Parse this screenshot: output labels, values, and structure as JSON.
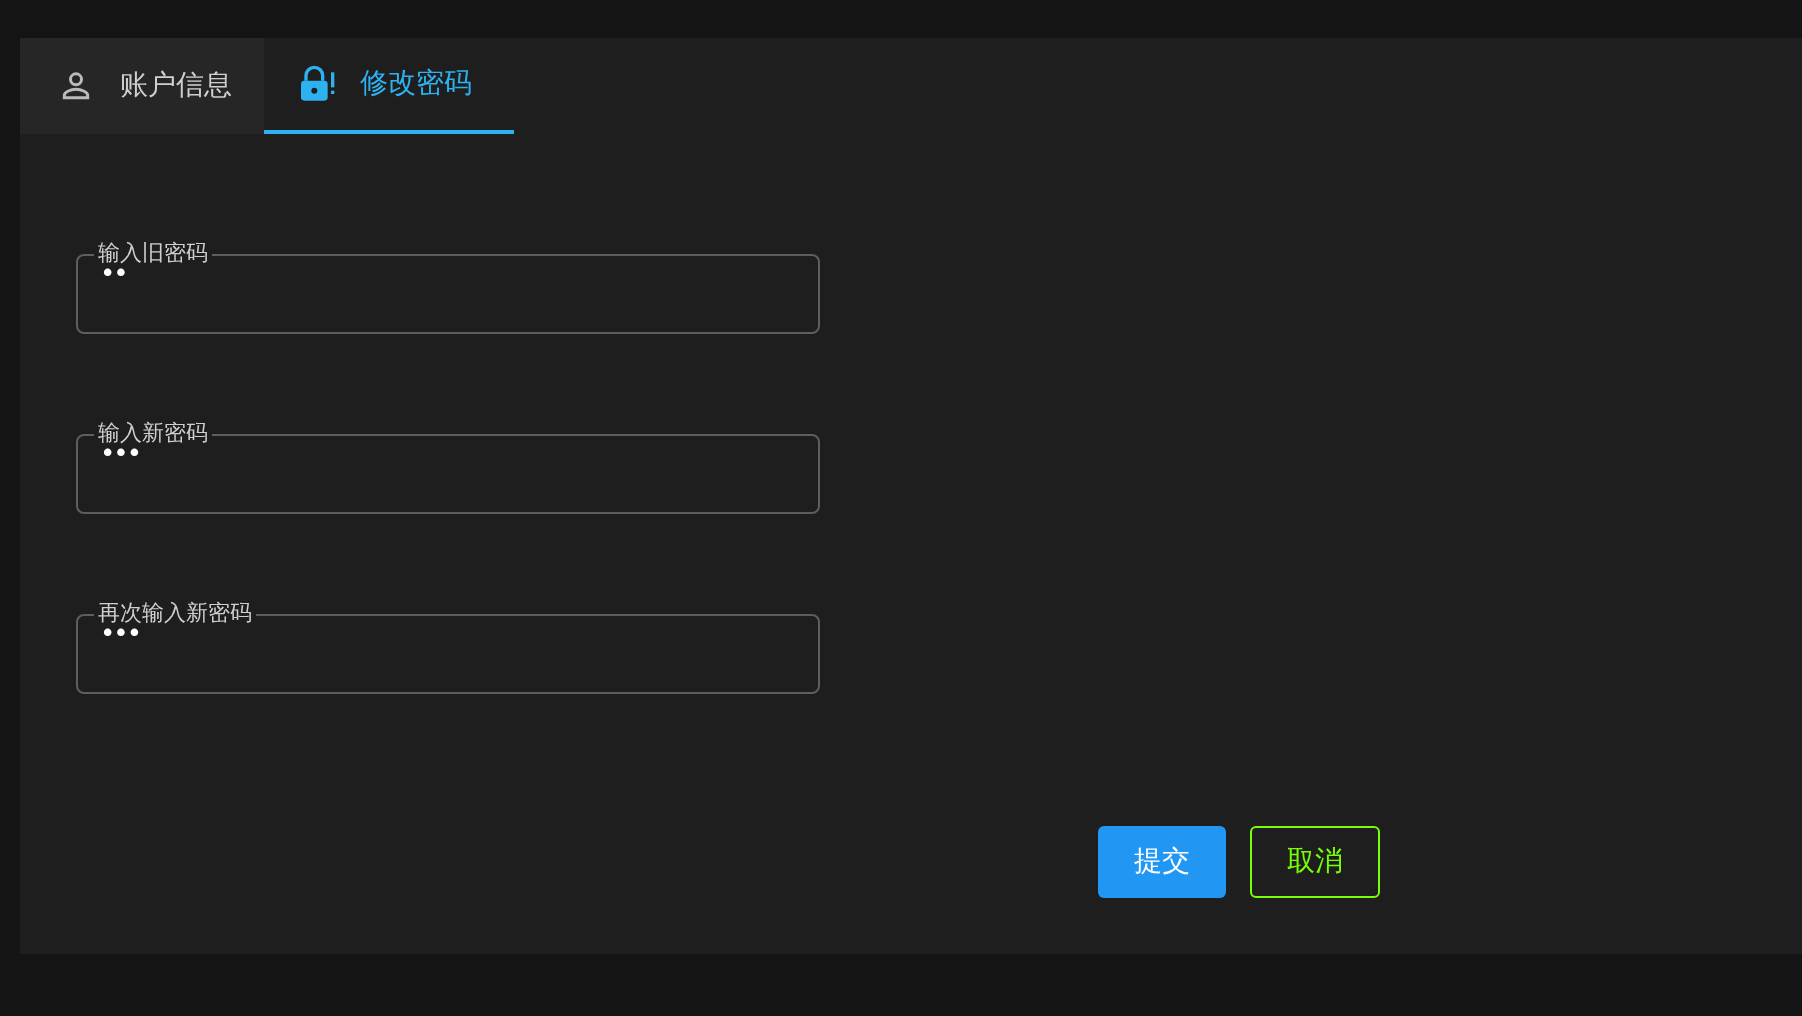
{
  "tabs": [
    {
      "label": "账户信息",
      "kind": "person",
      "selected": false
    },
    {
      "label": "修改密码",
      "kind": "lock",
      "selected": true
    }
  ],
  "fields": [
    {
      "label": "输入旧密码",
      "value": "••"
    },
    {
      "label": "输入新密码",
      "value": "•••"
    },
    {
      "label": "再次输入新密码",
      "value": "•••"
    }
  ],
  "buttons": [
    {
      "label": "提交",
      "kind": "primary"
    },
    {
      "label": "取消",
      "kind": "outline"
    }
  ]
}
